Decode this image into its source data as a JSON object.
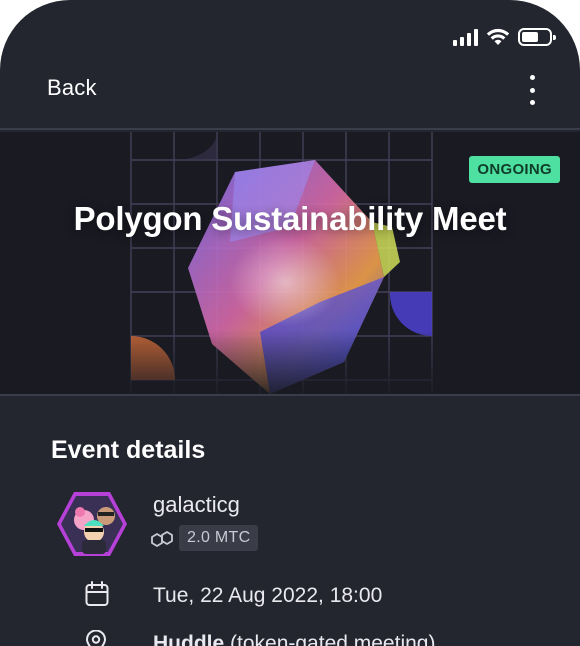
{
  "status_bar": {
    "icons": [
      "signal-icon",
      "wifi-icon",
      "battery-icon"
    ],
    "battery_level": 0.6
  },
  "nav": {
    "back_label": "Back",
    "menu_icon": "more-vertical-icon"
  },
  "hero": {
    "badge": "ONGOING",
    "title": "Polygon Sustainability Meet"
  },
  "details": {
    "section_title": "Event details",
    "host": {
      "name": "galacticg",
      "token_amount": "2.0 MTC",
      "token_icon": "polygon-icon"
    },
    "date": {
      "icon": "calendar-icon",
      "text": "Tue, 22 Aug 2022, 18:00"
    },
    "location": {
      "icon": "location-pin-icon",
      "name": "Huddle",
      "note": "(token-gated meeting)"
    }
  },
  "colors": {
    "background": "#23252f",
    "badge": "#4de0a0",
    "chip": "#3a3c48"
  }
}
